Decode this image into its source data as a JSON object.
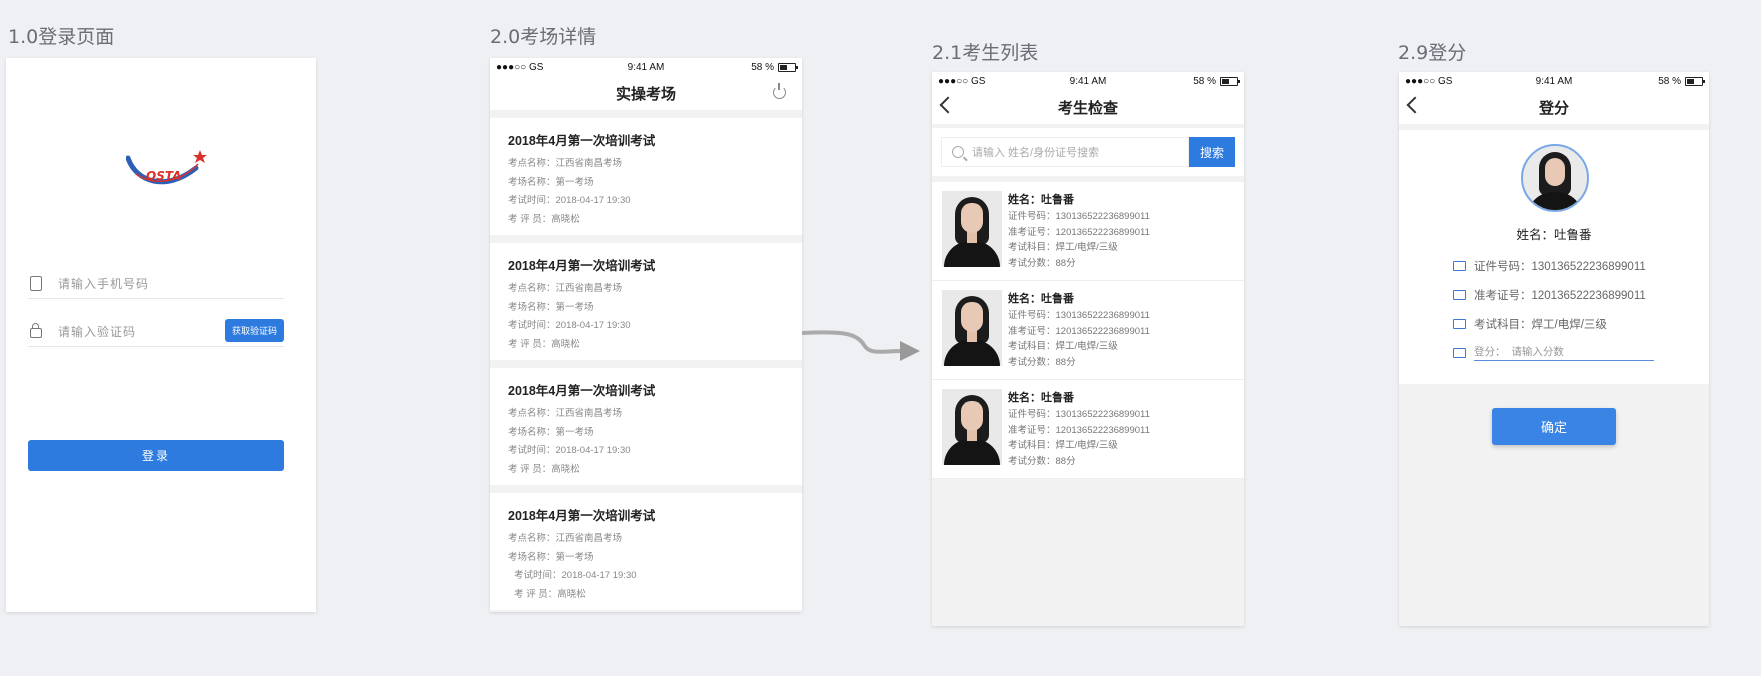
{
  "screens": {
    "login": {
      "frame_title": "1.0登录页面",
      "phone_placeholder": "请输入手机号码",
      "code_placeholder": "请输入验证码",
      "get_code_label": "获取验证码",
      "login_label": "登录",
      "logo_text": "OSTA"
    },
    "exam_list": {
      "frame_title": "2.0考场详情",
      "nav_title": "实操考场",
      "status": {
        "carrier": "●●●○○ GS",
        "time": "9:41 AM",
        "battery": "58 %"
      },
      "cards": [
        {
          "title": "2018年4月第一次培训考试",
          "site": "考点名称：江西省南昌考场",
          "room": "考场名称：第一考场",
          "time": "考试时间：2018-04-17 19:30",
          "examiner": "考  评  员：高晓松"
        },
        {
          "title": "2018年4月第一次培训考试",
          "site": "考点名称：江西省南昌考场",
          "room": "考场名称：第一考场",
          "time": "考试时间：2018-04-17 19:30",
          "examiner": "考  评  员：高晓松"
        },
        {
          "title": "2018年4月第一次培训考试",
          "site": "考点名称：江西省南昌考场",
          "room": "考场名称：第一考场",
          "time": "考试时间：2018-04-17 19:30",
          "examiner": "考  评  员：高晓松"
        },
        {
          "title": "2018年4月第一次培训考试",
          "site": "考点名称：江西省南昌考场",
          "room": "考场名称：第一考场",
          "time": "考试时间：2018-04-17 19:30",
          "examiner": "考  评  员：高晓松"
        }
      ]
    },
    "student_list": {
      "frame_title": "2.1考生列表",
      "nav_title": "考生检查",
      "search_placeholder": "请输入 姓名/身份证号搜索",
      "search_label": "搜索",
      "status": {
        "carrier": "●●●○○ GS",
        "time": "9:41 AM",
        "battery": "58 %"
      },
      "students": [
        {
          "name": "姓名：吐鲁番",
          "id_no": "证件号码：130136522236899011",
          "ticket": "准考证号：120136522236899011",
          "subject": "考试科目：焊工/电焊/三级",
          "score": "考试分数：88分"
        },
        {
          "name": "姓名：吐鲁番",
          "id_no": "证件号码：130136522236899011",
          "ticket": "准考证号：120136522236899011",
          "subject": "考试科目：焊工/电焊/三级",
          "score": "考试分数：88分"
        },
        {
          "name": "姓名：吐鲁番",
          "id_no": "证件号码：130136522236899011",
          "ticket": "准考证号：120136522236899011",
          "subject": "考试科目：焊工/电焊/三级",
          "score": "考试分数：88分"
        }
      ]
    },
    "score": {
      "frame_title": "2.9登分",
      "nav_title": "登分",
      "status": {
        "carrier": "●●●○○ GS",
        "time": "9:41 AM",
        "battery": "58 %"
      },
      "name": "姓名：吐鲁番",
      "id_no": "证件号码：130136522236899011",
      "ticket": "准考证号：120136522236899011",
      "subject": "考试科目：焊工/电焊/三级",
      "score_label": "登分：",
      "score_placeholder": "请输入分数",
      "confirm_label": "确定"
    }
  },
  "colors": {
    "accent": "#2e7be0",
    "background": "#eef0f4"
  }
}
